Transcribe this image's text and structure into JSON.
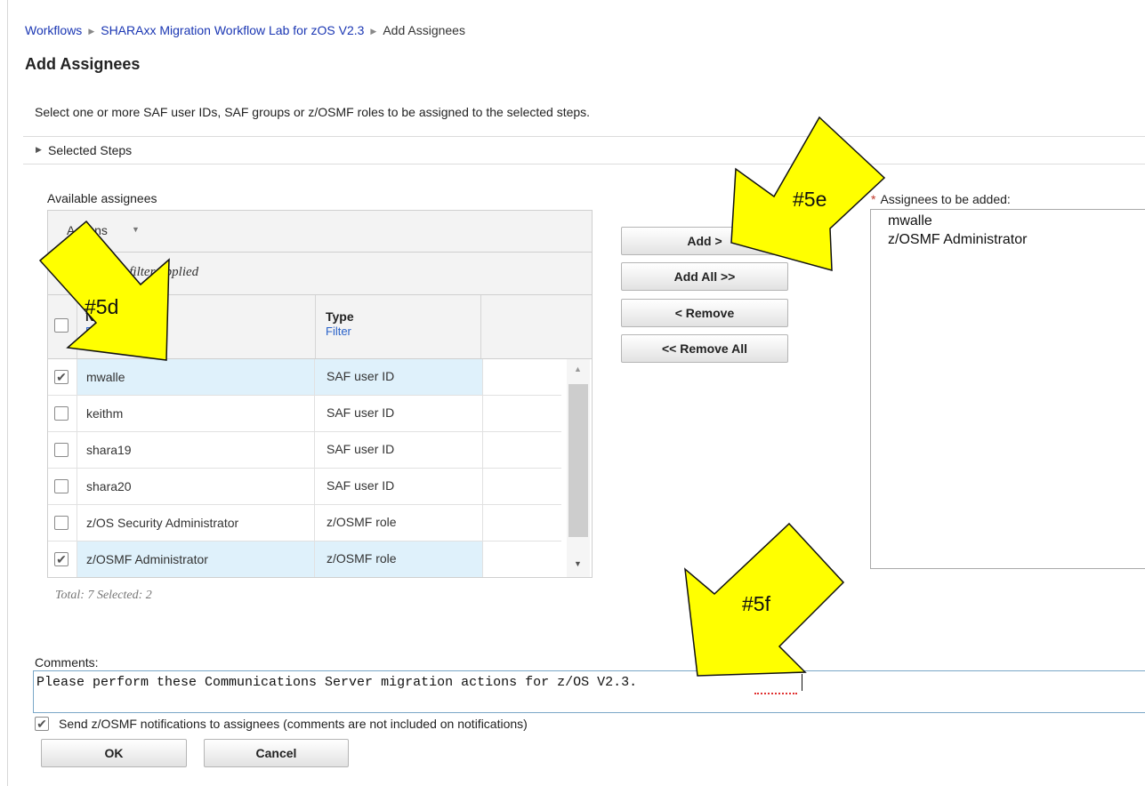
{
  "breadcrumb": {
    "items": [
      "Workflows",
      "SHARAxx Migration Workflow Lab for zOS V2.3"
    ],
    "current": "Add Assignees"
  },
  "page_title": "Add Assignees",
  "description": "Select one or more SAF user IDs, SAF groups or z/OSMF roles to be assigned to the selected steps.",
  "selected_steps_label": "Selected Steps",
  "available": {
    "label": "Available assignees",
    "actions_label": "Actions",
    "filter_status": "No filter applied",
    "columns": [
      {
        "name": "Name",
        "filter": "Filter"
      },
      {
        "name": "Type",
        "filter": "Filter"
      }
    ],
    "rows": [
      {
        "name": "mwalle",
        "type": "SAF user ID",
        "checked": true
      },
      {
        "name": "keithm",
        "type": "SAF user ID",
        "checked": false
      },
      {
        "name": "shara19",
        "type": "SAF user ID",
        "checked": false
      },
      {
        "name": "shara20",
        "type": "SAF user ID",
        "checked": false
      },
      {
        "name": "z/OS Security Administrator",
        "type": "z/OSMF role",
        "checked": false
      },
      {
        "name": "z/OSMF Administrator",
        "type": "z/OSMF role",
        "checked": true
      }
    ],
    "total_text": "Total: 7 Selected: 2"
  },
  "buttons": {
    "add": "Add >",
    "add_all": "Add All >>",
    "remove": "< Remove",
    "remove_all": "<< Remove All",
    "ok": "OK",
    "cancel": "Cancel"
  },
  "assignees": {
    "required_mark": "*",
    "label": "Assignees to be added:",
    "items": [
      "mwalle",
      "z/OSMF Administrator"
    ]
  },
  "comments": {
    "label": "Comments:",
    "value": "Please perform these Communications Server migration actions for z/OS V2.3."
  },
  "notify": {
    "checked": true,
    "label": "Send z/OSMF notifications to assignees (comments are not included on notifications)"
  },
  "annotations": [
    "#5d",
    "#5e",
    "#5f"
  ],
  "colors": {
    "arrow_fill": "#ffff00",
    "link": "#1a36b3",
    "selected_row": "#dff1fb"
  }
}
